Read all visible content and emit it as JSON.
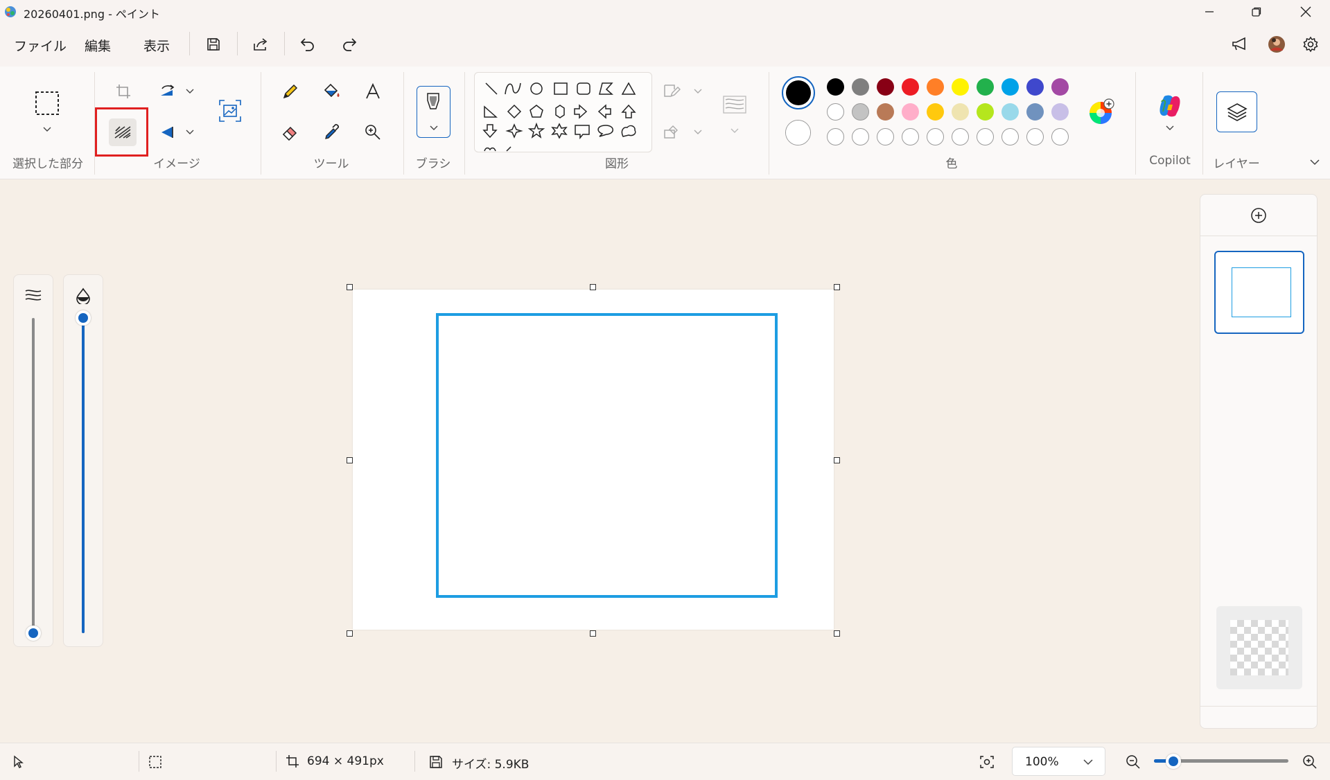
{
  "window": {
    "title": "20260401.png - ペイント",
    "minimize_icon": "minimize-icon",
    "restore_icon": "restore-icon",
    "close_icon": "close-icon"
  },
  "menu": {
    "file": "ファイル",
    "edit": "編集",
    "view": "表示"
  },
  "ribbon": {
    "groups": {
      "selection": "選択した部分",
      "image": "イメージ",
      "tools": "ツール",
      "brush": "ブラシ",
      "shapes": "図形",
      "colors": "色",
      "copilot": "Copilot",
      "layers": "レイヤー"
    },
    "highlighted_tool": "background-removal-icon"
  },
  "colors": {
    "primary": "#000000",
    "secondary": "#ffffff",
    "palette_row1": [
      "#000000",
      "#7f7f7f",
      "#880015",
      "#ed1c24",
      "#ff7f27",
      "#fff200",
      "#22b14c",
      "#00a2e8",
      "#3f48cc",
      "#a349a4"
    ],
    "palette_row2": [
      "#ffffff",
      "#c3c3c3",
      "#b97a57",
      "#ffaec9",
      "#ffc90e",
      "#efe4b0",
      "#b5e61d",
      "#99d9ea",
      "#7092be",
      "#c8bfe7"
    ],
    "shape_outline": "#1d9de2",
    "highlight_box": "#e02020",
    "accent": "#1565c0"
  },
  "sliders": {
    "size_fraction": 0.0,
    "opacity_fraction": 1.0
  },
  "status": {
    "dimensions": "694 × 491px",
    "file_size": "サイズ: 5.9KB",
    "zoom": "100%"
  }
}
